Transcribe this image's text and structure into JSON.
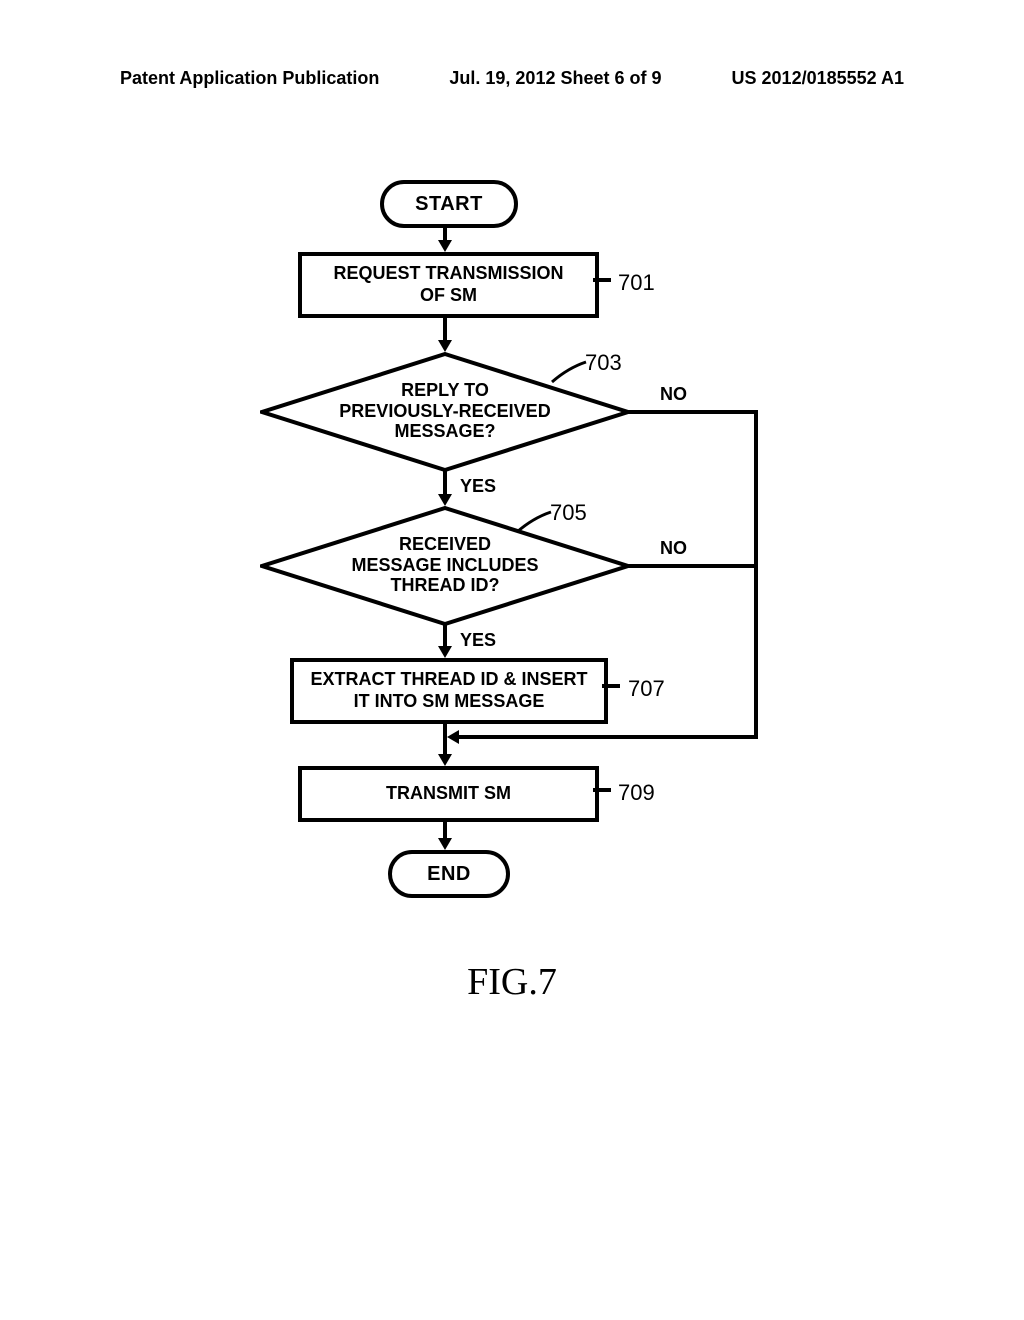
{
  "header": {
    "left": "Patent Application Publication",
    "center": "Jul. 19, 2012  Sheet 6 of 9",
    "right": "US 2012/0185552 A1"
  },
  "flowchart": {
    "start": "START",
    "end": "END",
    "step701": "REQUEST TRANSMISSION\nOF SM",
    "step703": "REPLY TO\nPREVIOUSLY-RECEIVED\nMESSAGE?",
    "step705": "RECEIVED\nMESSAGE INCLUDES\nTHREAD ID?",
    "step707": "EXTRACT THREAD ID & INSERT\nIT INTO SM MESSAGE",
    "step709": "TRANSMIT SM",
    "yes": "YES",
    "no": "NO",
    "ref701": "701",
    "ref703": "703",
    "ref705": "705",
    "ref707": "707",
    "ref709": "709"
  },
  "figure": "FIG.7"
}
